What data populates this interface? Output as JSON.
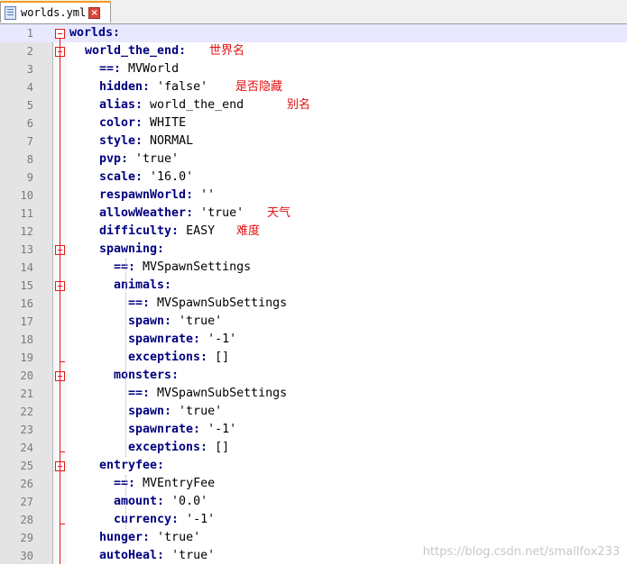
{
  "tab": {
    "filename": "worlds.yml",
    "close": "×"
  },
  "lines": [
    {
      "n": "1",
      "key": "worlds:",
      "val": ""
    },
    {
      "n": "2",
      "key": "world_the_end:",
      "val": ""
    },
    {
      "n": "3",
      "key": "==: ",
      "val": "MVWorld"
    },
    {
      "n": "4",
      "key": "hidden: ",
      "val": "'false'"
    },
    {
      "n": "5",
      "key": "alias: ",
      "val": "world_the_end"
    },
    {
      "n": "6",
      "key": "color: ",
      "val": "WHITE"
    },
    {
      "n": "7",
      "key": "style: ",
      "val": "NORMAL"
    },
    {
      "n": "8",
      "key": "pvp: ",
      "val": "'true'"
    },
    {
      "n": "9",
      "key": "scale: ",
      "val": "'16.0'"
    },
    {
      "n": "10",
      "key": "respawnWorld: ",
      "val": "''"
    },
    {
      "n": "11",
      "key": "allowWeather: ",
      "val": "'true'"
    },
    {
      "n": "12",
      "key": "difficulty: ",
      "val": "EASY"
    },
    {
      "n": "13",
      "key": "spawning:",
      "val": ""
    },
    {
      "n": "14",
      "key": "==: ",
      "val": "MVSpawnSettings"
    },
    {
      "n": "15",
      "key": "animals:",
      "val": ""
    },
    {
      "n": "16",
      "key": "==: ",
      "val": "MVSpawnSubSettings"
    },
    {
      "n": "17",
      "key": "spawn: ",
      "val": "'true'"
    },
    {
      "n": "18",
      "key": "spawnrate: ",
      "val": "'-1'"
    },
    {
      "n": "19",
      "key": "exceptions: ",
      "val": "[]"
    },
    {
      "n": "20",
      "key": "monsters:",
      "val": ""
    },
    {
      "n": "21",
      "key": "==: ",
      "val": "MVSpawnSubSettings"
    },
    {
      "n": "22",
      "key": "spawn: ",
      "val": "'true'"
    },
    {
      "n": "23",
      "key": "spawnrate: ",
      "val": "'-1'"
    },
    {
      "n": "24",
      "key": "exceptions: ",
      "val": "[]"
    },
    {
      "n": "25",
      "key": "entryfee:",
      "val": ""
    },
    {
      "n": "26",
      "key": "==: ",
      "val": "MVEntryFee"
    },
    {
      "n": "27",
      "key": "amount: ",
      "val": "'0.0'"
    },
    {
      "n": "28",
      "key": "currency: ",
      "val": "'-1'"
    },
    {
      "n": "29",
      "key": "hunger: ",
      "val": "'true'"
    },
    {
      "n": "30",
      "key": "autoHeal: ",
      "val": "'true'"
    }
  ],
  "notes": {
    "world_name": "世界名",
    "hidden": "是否隐藏",
    "alias": "别名",
    "weather": "天气",
    "difficulty": "难度"
  },
  "watermark": "https://blog.csdn.net/smallfox233"
}
